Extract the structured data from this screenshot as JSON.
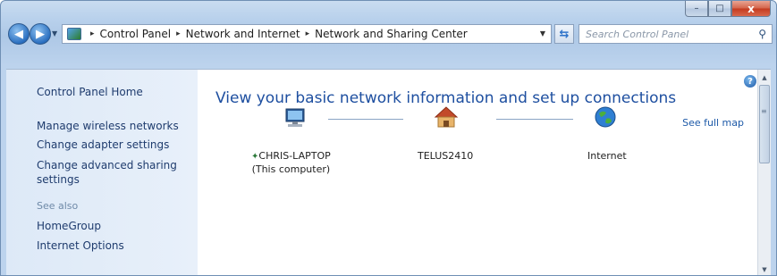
{
  "window": {
    "caption_buttons": {
      "minimize": "–",
      "maximize": "□",
      "close": "x"
    }
  },
  "nav": {
    "back_icon": "back-arrow-icon",
    "forward_icon": "forward-arrow-icon",
    "breadcrumb": [
      "Control Panel",
      "Network and Internet",
      "Network and Sharing Center"
    ],
    "separator": "▸",
    "search_placeholder": "Search Control Panel"
  },
  "left_pane": {
    "home": "Control Panel Home",
    "tasks": [
      "Manage wireless networks",
      "Change adapter settings",
      "Change advanced sharing settings"
    ],
    "see_also_header": "See also",
    "see_also": [
      "HomeGroup",
      "Internet Options"
    ]
  },
  "main": {
    "title": "View your basic network information and set up connections",
    "see_full_map": "See full map",
    "nodes": [
      {
        "name": "CHRIS-LAPTOP",
        "sub": "(This computer)",
        "icon": "computer-icon"
      },
      {
        "name": "TELUS2410",
        "icon": "home-network-icon"
      },
      {
        "name": "Internet",
        "icon": "globe-icon"
      }
    ]
  },
  "colors": {
    "link": "#1f3c6e",
    "title": "#1e4fa0",
    "frame": "#b9d1ec",
    "close": "#c43a1f"
  }
}
